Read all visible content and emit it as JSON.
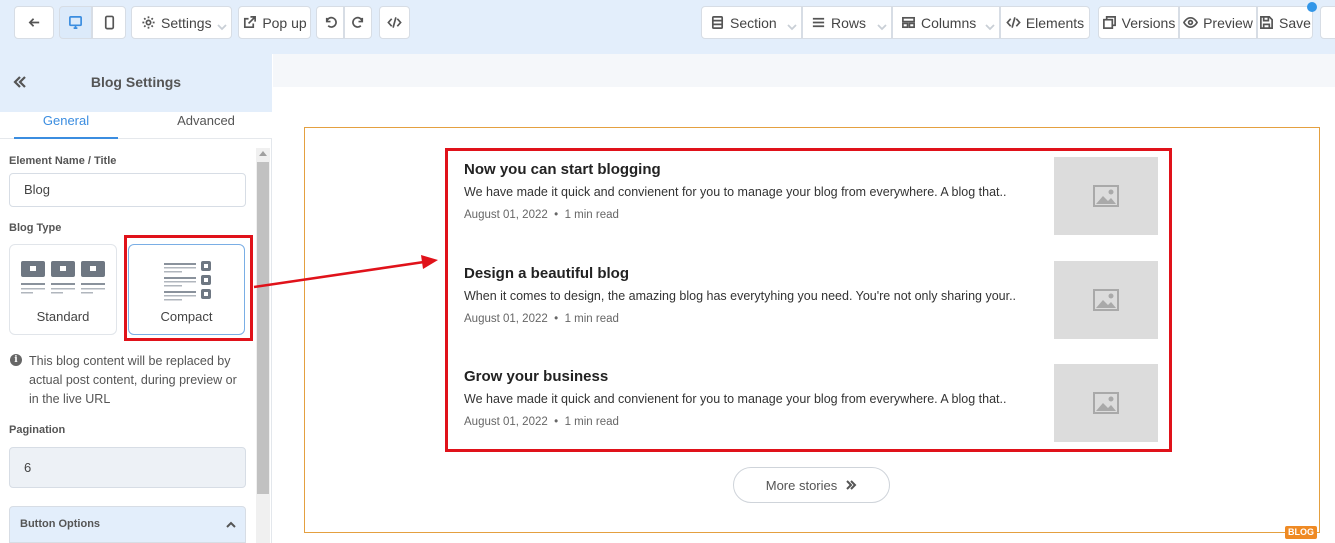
{
  "toolbar": {
    "settings_label": "Settings",
    "popup_label": "Pop up",
    "section_label": "Section",
    "rows_label": "Rows",
    "columns_label": "Columns",
    "elements_label": "Elements",
    "versions_label": "Versions",
    "preview_label": "Preview",
    "save_label": "Save"
  },
  "sidebar": {
    "title": "Blog Settings",
    "tabs": [
      {
        "label": "General",
        "active": true
      },
      {
        "label": "Advanced",
        "active": false
      }
    ],
    "element_name_label": "Element Name / Title",
    "element_name_value": "Blog",
    "blog_type_label": "Blog Type",
    "blog_types": [
      {
        "label": "Standard",
        "selected": false
      },
      {
        "label": "Compact",
        "selected": true
      }
    ],
    "info_text": "This blog content will be replaced by actual post content, during preview or in the live URL",
    "pagination_label": "Pagination",
    "pagination_value": "6",
    "button_options_label": "Button Options"
  },
  "blog": {
    "posts": [
      {
        "title": "Now you can start blogging",
        "excerpt": "We have made it quick and convienent for you to manage your blog from everywhere. A blog that..",
        "date": "August 01, 2022",
        "read_time": "1 min read"
      },
      {
        "title": "Design a beautiful blog",
        "excerpt": "When it comes to design, the amazing blog has everytyhing you need. You're not only sharing your..",
        "date": "August 01, 2022",
        "read_time": "1 min read"
      },
      {
        "title": "Grow your business",
        "excerpt": "We have made it quick and convienent for you to manage your blog from everywhere. A blog that..",
        "date": "August 01, 2022",
        "read_time": "1 min read"
      }
    ],
    "more_label": "More stories",
    "tag_label": "BLOG"
  },
  "colors": {
    "accent": "#3b8de0",
    "highlight": "#e0121a",
    "frame": "#e4a040",
    "toolbar_bg": "#e3eefb"
  }
}
